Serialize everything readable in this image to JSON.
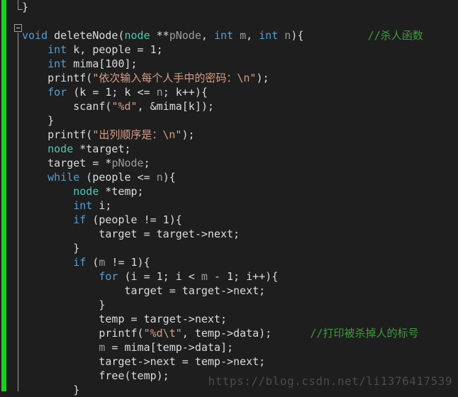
{
  "editor": {
    "background_color": "#1e1e1e",
    "change_bar_color": "#1bd11b",
    "default_text_color": "#dcdcdc",
    "colors": {
      "keyword": "#569cd6",
      "type": "#4ec9b0",
      "parameter": "#9a9a9a",
      "string": "#d69d85",
      "comment": "#3e9b3e",
      "plain": "#dcdcdc",
      "watermark": "#4b4b4b",
      "outline_guide": "#9d9d9d"
    },
    "collapse_glyph": "minus-square",
    "watermark": "https://blog.csdn.net/li1376417539"
  },
  "code": {
    "lines": [
      {
        "n": 1,
        "tokens": [
          {
            "t": "}",
            "c": "pln"
          }
        ]
      },
      {
        "n": 2,
        "tokens": []
      },
      {
        "n": 3,
        "tokens": [
          {
            "t": "void",
            "c": "kw"
          },
          {
            "t": " deleteNode(",
            "c": "pln"
          },
          {
            "t": "node",
            "c": "typ"
          },
          {
            "t": " **",
            "c": "pln"
          },
          {
            "t": "pNode",
            "c": "par"
          },
          {
            "t": ", ",
            "c": "pln"
          },
          {
            "t": "int",
            "c": "kw"
          },
          {
            "t": " ",
            "c": "pln"
          },
          {
            "t": "m",
            "c": "par"
          },
          {
            "t": ", ",
            "c": "pln"
          },
          {
            "t": "int",
            "c": "kw"
          },
          {
            "t": " ",
            "c": "pln"
          },
          {
            "t": "n",
            "c": "par"
          },
          {
            "t": "){",
            "c": "pln"
          },
          {
            "t": "          ",
            "c": "pln"
          },
          {
            "t": "//杀人函数",
            "c": "cmt"
          }
        ]
      },
      {
        "n": 4,
        "tokens": [
          {
            "t": "    ",
            "c": "pln"
          },
          {
            "t": "int",
            "c": "kw"
          },
          {
            "t": " k, people = 1;",
            "c": "pln"
          }
        ]
      },
      {
        "n": 5,
        "tokens": [
          {
            "t": "    ",
            "c": "pln"
          },
          {
            "t": "int",
            "c": "kw"
          },
          {
            "t": " mima[100];",
            "c": "pln"
          }
        ]
      },
      {
        "n": 6,
        "tokens": [
          {
            "t": "    printf(",
            "c": "pln"
          },
          {
            "t": "\"依次输入每个人手中的密码：\\n\"",
            "c": "str"
          },
          {
            "t": ");",
            "c": "pln"
          }
        ]
      },
      {
        "n": 7,
        "tokens": [
          {
            "t": "    ",
            "c": "pln"
          },
          {
            "t": "for",
            "c": "kw"
          },
          {
            "t": " (k = 1; k <= ",
            "c": "pln"
          },
          {
            "t": "n",
            "c": "par"
          },
          {
            "t": "; k++){",
            "c": "pln"
          }
        ]
      },
      {
        "n": 8,
        "tokens": [
          {
            "t": "        scanf(",
            "c": "pln"
          },
          {
            "t": "\"%d\"",
            "c": "str"
          },
          {
            "t": ", &mima[k]);",
            "c": "pln"
          }
        ]
      },
      {
        "n": 9,
        "tokens": [
          {
            "t": "    }",
            "c": "pln"
          }
        ]
      },
      {
        "n": 10,
        "tokens": [
          {
            "t": "    printf(",
            "c": "pln"
          },
          {
            "t": "\"出列顺序是：\\n\"",
            "c": "str"
          },
          {
            "t": ");",
            "c": "pln"
          }
        ]
      },
      {
        "n": 11,
        "tokens": [
          {
            "t": "    ",
            "c": "pln"
          },
          {
            "t": "node",
            "c": "typ"
          },
          {
            "t": " *target;",
            "c": "pln"
          }
        ]
      },
      {
        "n": 12,
        "tokens": [
          {
            "t": "    target = *",
            "c": "pln"
          },
          {
            "t": "pNode",
            "c": "par"
          },
          {
            "t": ";",
            "c": "pln"
          }
        ]
      },
      {
        "n": 13,
        "tokens": [
          {
            "t": "    ",
            "c": "pln"
          },
          {
            "t": "while",
            "c": "kw"
          },
          {
            "t": " (people <= ",
            "c": "pln"
          },
          {
            "t": "n",
            "c": "par"
          },
          {
            "t": "){",
            "c": "pln"
          }
        ]
      },
      {
        "n": 14,
        "tokens": [
          {
            "t": "        ",
            "c": "pln"
          },
          {
            "t": "node",
            "c": "typ"
          },
          {
            "t": " *temp;",
            "c": "pln"
          }
        ]
      },
      {
        "n": 15,
        "tokens": [
          {
            "t": "        ",
            "c": "pln"
          },
          {
            "t": "int",
            "c": "kw"
          },
          {
            "t": " i;",
            "c": "pln"
          }
        ]
      },
      {
        "n": 16,
        "tokens": [
          {
            "t": "        ",
            "c": "pln"
          },
          {
            "t": "if",
            "c": "kw"
          },
          {
            "t": " (people != 1){",
            "c": "pln"
          }
        ]
      },
      {
        "n": 17,
        "tokens": [
          {
            "t": "            target = target->next;",
            "c": "pln"
          }
        ]
      },
      {
        "n": 18,
        "tokens": [
          {
            "t": "        }",
            "c": "pln"
          }
        ]
      },
      {
        "n": 19,
        "tokens": [
          {
            "t": "        ",
            "c": "pln"
          },
          {
            "t": "if",
            "c": "kw"
          },
          {
            "t": " (",
            "c": "pln"
          },
          {
            "t": "m",
            "c": "par"
          },
          {
            "t": " != 1){",
            "c": "pln"
          }
        ]
      },
      {
        "n": 20,
        "tokens": [
          {
            "t": "            ",
            "c": "pln"
          },
          {
            "t": "for",
            "c": "kw"
          },
          {
            "t": " (i = 1; i < ",
            "c": "pln"
          },
          {
            "t": "m",
            "c": "par"
          },
          {
            "t": " - 1; i++){",
            "c": "pln"
          }
        ]
      },
      {
        "n": 21,
        "tokens": [
          {
            "t": "                target = target->next;",
            "c": "pln"
          }
        ]
      },
      {
        "n": 22,
        "tokens": [
          {
            "t": "            }",
            "c": "pln"
          }
        ]
      },
      {
        "n": 23,
        "tokens": [
          {
            "t": "            temp = target->next;",
            "c": "pln"
          }
        ]
      },
      {
        "n": 24,
        "tokens": [
          {
            "t": "            printf(",
            "c": "pln"
          },
          {
            "t": "\"%d\\t\"",
            "c": "str"
          },
          {
            "t": ", temp->data);",
            "c": "pln"
          },
          {
            "t": "      ",
            "c": "pln"
          },
          {
            "t": "//打印被杀掉人的标号",
            "c": "cmt"
          }
        ]
      },
      {
        "n": 25,
        "tokens": [
          {
            "t": "            ",
            "c": "pln"
          },
          {
            "t": "m",
            "c": "par"
          },
          {
            "t": " = mima[temp->data];",
            "c": "pln"
          }
        ]
      },
      {
        "n": 26,
        "tokens": [
          {
            "t": "            target->next = temp->next;",
            "c": "pln"
          }
        ]
      },
      {
        "n": 27,
        "tokens": [
          {
            "t": "            free(temp);",
            "c": "pln"
          }
        ]
      },
      {
        "n": 28,
        "tokens": [
          {
            "t": "        }",
            "c": "pln"
          }
        ]
      }
    ]
  }
}
